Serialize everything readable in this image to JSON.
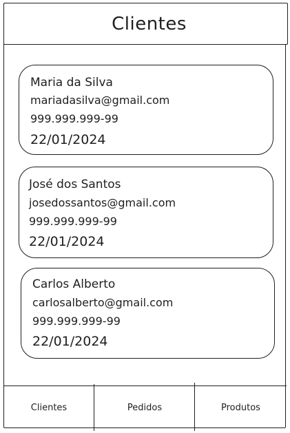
{
  "header": {
    "title": "Clientes"
  },
  "clients": [
    {
      "name": "Maria da Silva",
      "email": "mariadasilva@gmail.com",
      "phone": "999.999.999-99",
      "date": "22/01/2024"
    },
    {
      "name": "José dos Santos",
      "email": "josedossantos@gmail.com",
      "phone": "999.999.999-99",
      "date": "22/01/2024"
    },
    {
      "name": "Carlos Alberto",
      "email": "carlosalberto@gmail.com",
      "phone": "999.999.999-99",
      "date": "22/01/2024"
    }
  ],
  "tabbar": {
    "tabs": [
      {
        "label": "Clientes"
      },
      {
        "label": "Pedidos"
      },
      {
        "label": "Produtos"
      }
    ]
  },
  "colors": {
    "stroke": "#1e1e1e",
    "background": "#ffffff"
  }
}
